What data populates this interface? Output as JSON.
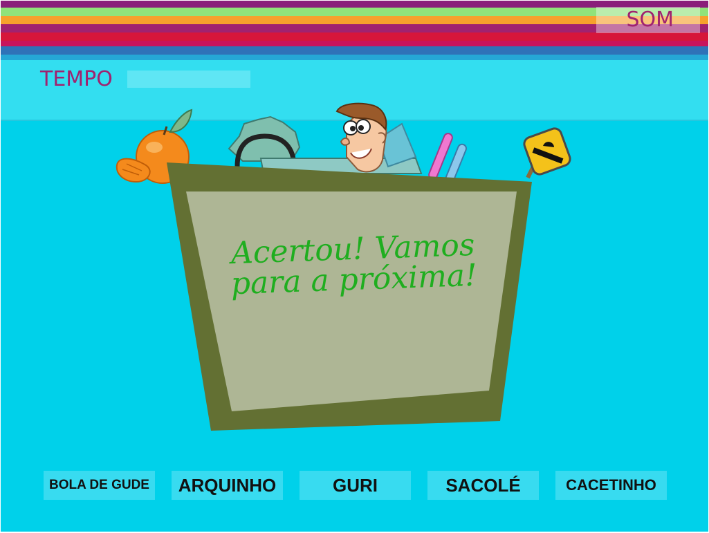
{
  "header": {
    "sound_label": "SOM",
    "time_label": "TEMPO"
  },
  "board": {
    "message": "Acertou! Vamos para a próxima!"
  },
  "answers": [
    {
      "label": "BOLA DE GUDE"
    },
    {
      "label": "ARQUINHO"
    },
    {
      "label": "GURI"
    },
    {
      "label": "SACOLÉ"
    },
    {
      "label": "CACETINHO"
    }
  ],
  "colors": {
    "background": "#00d1ea",
    "accent_text": "#a0226f",
    "message_text": "#1fae1f",
    "board_frame": "#637033",
    "board_inner": "#aeb695",
    "stripes": [
      "#8a1f7a",
      "#90e37a",
      "#f6a12c",
      "#a0226f",
      "#d6163a",
      "#2f72b8"
    ]
  }
}
